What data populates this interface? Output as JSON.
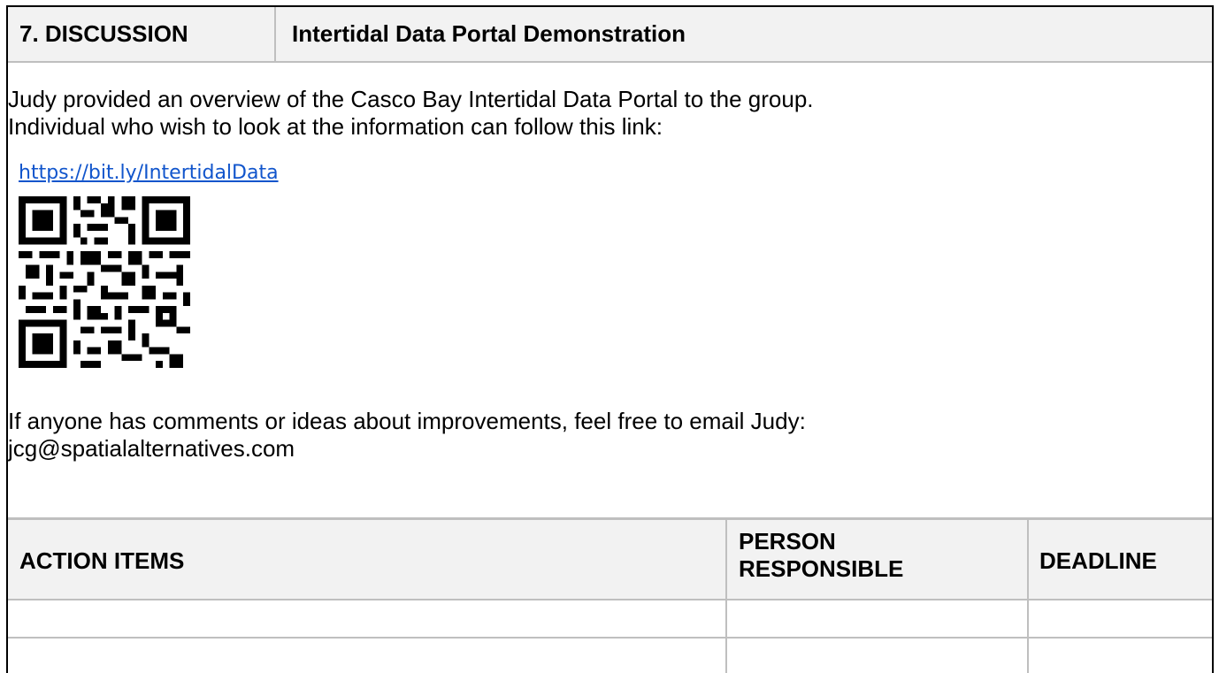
{
  "header": {
    "number": "7. DISCUSSION",
    "title": "Intertidal Data Portal Demonstration"
  },
  "body": {
    "line1": "Judy provided an overview of the Casco Bay Intertidal Data Portal to the group.",
    "line2": "Individual who wish to look at the information can follow this link:",
    "link": "https://bit.ly/IntertidalData",
    "qr_icon": "qr-code-icon",
    "line3": "If anyone has comments or ideas about improvements, feel free to email Judy:",
    "line4": "jcg@spatialalternatives.com"
  },
  "action_table": {
    "columns": [
      "ACTION ITEMS",
      "PERSON",
      "RESPONSIBLE",
      "DEADLINE"
    ],
    "rows": [
      [
        "",
        "",
        ""
      ],
      [
        "",
        "",
        ""
      ]
    ]
  },
  "colors": {
    "header_bg": "#f2f2f2",
    "border": "#bfbfbf",
    "link": "#1155cc"
  }
}
